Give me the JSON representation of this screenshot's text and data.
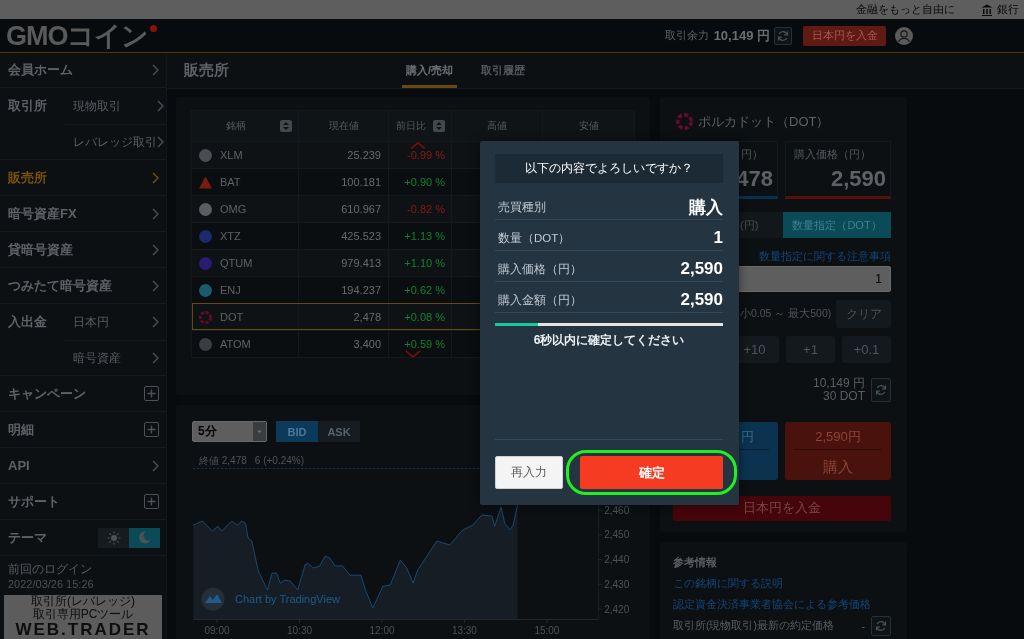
{
  "top_strip": {
    "tagline": "金融をもっと自由に",
    "bank_link": "銀行"
  },
  "header": {
    "logo": "GMOコイン",
    "balance_label": "取引余力",
    "balance_value": "10,149 円",
    "deposit_button": "日本円を入金"
  },
  "sidebar": {
    "items": [
      {
        "label": "会員ホーム",
        "kind": "link",
        "selected": false
      },
      {
        "label": "取引所",
        "kind": "group",
        "selected": false,
        "children": [
          {
            "label": "現物取引",
            "selected": false
          },
          {
            "label": "レバレッジ取引",
            "selected": false
          }
        ]
      },
      {
        "label": "販売所",
        "kind": "link",
        "selected": true
      },
      {
        "label": "暗号資産FX",
        "kind": "link",
        "selected": false
      },
      {
        "label": "貸暗号資産",
        "kind": "link",
        "selected": false
      },
      {
        "label": "つみたて暗号資産",
        "kind": "link",
        "selected": false
      },
      {
        "label": "入出金",
        "kind": "group",
        "selected": false,
        "children": [
          {
            "label": "日本円",
            "selected": false
          },
          {
            "label": "暗号資産",
            "selected": false
          }
        ]
      },
      {
        "label": "キャンペーン",
        "kind": "expand",
        "selected": false
      },
      {
        "label": "明細",
        "kind": "expand",
        "selected": false
      },
      {
        "label": "API",
        "kind": "link",
        "selected": false
      },
      {
        "label": "サポート",
        "kind": "expand",
        "selected": false
      },
      {
        "label": "テーマ",
        "kind": "theme",
        "selected": false,
        "options": [
          {
            "kind": "light",
            "selected": false
          },
          {
            "kind": "dark",
            "selected": true
          }
        ]
      }
    ],
    "last_login_label": "前回のログイン",
    "last_login": "2022/03/26 15:26",
    "banner": {
      "caption": "取引所(レバレッジ)取引専用PCツール",
      "title": "WEB.TRADER"
    }
  },
  "page": {
    "title": "販売所",
    "tabs": [
      {
        "label": "購入/売却",
        "selected": true
      },
      {
        "label": "取引履歴",
        "selected": false
      }
    ]
  },
  "market_table": {
    "columns": [
      {
        "label": "銘柄",
        "sortable": true
      },
      {
        "label": "現在値",
        "sortable": false
      },
      {
        "label": "前日比",
        "sortable": true
      },
      {
        "label": "高値",
        "sortable": false
      },
      {
        "label": "安値",
        "sortable": false
      }
    ],
    "rows": [
      {
        "symbol": "XLM",
        "price": "25.239",
        "change": "-0.99 %",
        "rising": false,
        "kind": "circle",
        "color": "#4a4e52",
        "selected": false
      },
      {
        "symbol": "BAT",
        "price": "100.181",
        "change": "+0.90 %",
        "rising": true,
        "kind": "triangle",
        "color": "#7a1c0c",
        "selected": false
      },
      {
        "symbol": "OMG",
        "price": "610.967",
        "change": "-0.82 %",
        "rising": false,
        "kind": "circle",
        "color": "#5a5e62",
        "selected": false
      },
      {
        "symbol": "XTZ",
        "price": "425.523",
        "change": "+1.13 %",
        "rising": true,
        "kind": "circle",
        "color": "#1a2a6a",
        "selected": false
      },
      {
        "symbol": "QTUM",
        "price": "979.413",
        "change": "+1.10 %",
        "rising": true,
        "kind": "circle",
        "color": "#2a1a70",
        "selected": false
      },
      {
        "symbol": "ENJ",
        "price": "194.237",
        "change": "+0.62 %",
        "rising": true,
        "kind": "circle",
        "color": "#1a5a6a",
        "selected": false
      },
      {
        "symbol": "DOT",
        "price": "2,478",
        "change": "+0.08 %",
        "rising": true,
        "kind": "ring",
        "color": "#6a0a2a",
        "selected": true
      },
      {
        "symbol": "ATOM",
        "price": "3,400",
        "change": "+0.59 %",
        "rising": true,
        "kind": "circle",
        "color": "#3a3e42",
        "selected": false
      }
    ]
  },
  "chart": {
    "interval": "5分",
    "sides": [
      {
        "label": "BID",
        "selected": true
      },
      {
        "label": "ASK",
        "selected": false
      }
    ],
    "close_label": "終値 2,478",
    "close_change": "6 (+0.24%)",
    "attribution": "Chart by TradingView",
    "chart_data": {
      "type": "area",
      "x": [
        514,
        524,
        535,
        541,
        545,
        556,
        562,
        567,
        571,
        574,
        578,
        585,
        595,
        600,
        605,
        609,
        614,
        620,
        628,
        636,
        639,
        645,
        652,
        658,
        663,
        669,
        677,
        685,
        697,
        702,
        710,
        721,
        729,
        740,
        747,
        754,
        759,
        769,
        780,
        794,
        808,
        819,
        829,
        840,
        843,
        850,
        854,
        860,
        863,
        868
      ],
      "values": [
        2453.9,
        2455.6,
        2451.5,
        2453.5,
        2451.5,
        2455.6,
        2453.9,
        2455.6,
        2454.7,
        2448.7,
        2447.5,
        2435.4,
        2427.7,
        2434.5,
        2434.5,
        2430.5,
        2431.7,
        2431.3,
        2427.7,
        2437.8,
        2438.6,
        2436.6,
        2437.4,
        2441.4,
        2440.6,
        2437.4,
        2437.4,
        2433.7,
        2433.7,
        2427.7,
        2420.4,
        2429.3,
        2429.7,
        2439.8,
        2436.6,
        2430.5,
        2435.8,
        2441.4,
        2447.5,
        2445.9,
        2451.9,
        2453.9,
        2458,
        2457.6,
        2453.5,
        2461.2,
        2454.7,
        2451.9,
        2453.9,
        2462
      ],
      "xlim": [
        514,
        956
      ],
      "ylim": [
        2416,
        2477
      ],
      "xticks": [
        {
          "value": 540,
          "label": "09:00"
        },
        {
          "value": 630,
          "label": "10:30"
        },
        {
          "value": 720,
          "label": "12:00"
        },
        {
          "value": 810,
          "label": "13:30"
        },
        {
          "value": 900,
          "label": "15:00"
        }
      ],
      "yticks": [
        {
          "value": 2420,
          "label": "2,420"
        },
        {
          "value": 2430,
          "label": "2,430"
        },
        {
          "value": 2440,
          "label": "2,440"
        },
        {
          "value": 2450,
          "label": "2,450"
        },
        {
          "value": 2460,
          "label": "2,460"
        }
      ]
    }
  },
  "order_panel": {
    "title": "ポルカドット（DOT）",
    "sell_price": {
      "label": "円）",
      "value": "478"
    },
    "buy_price": {
      "label": "購入価格（円）",
      "value": "2,590"
    },
    "order_modes": [
      {
        "label": "(円)",
        "selected": false
      },
      {
        "label": "数量指定（DOT）",
        "selected": true
      }
    ],
    "notice_link": "数量指定に関する注意事項",
    "quantity": {
      "value": "1"
    },
    "range": "小0.05 ～ 最大500)",
    "clear_button": "クリア",
    "increments": [
      "+10",
      "+1",
      "+0.1"
    ],
    "available_jpy": "10,149 円",
    "available_dot": "30 DOT",
    "sell_button": {
      "price": "円"
    },
    "buy_button": {
      "price": "2,590円",
      "label": "購入"
    },
    "deposit_button": "日本円を入金"
  },
  "reference": {
    "title": "参考情報",
    "links": [
      "この銘柄に関する説明",
      "認定資金決済事業者協会による参考価格"
    ],
    "last_trade_label": "取引所(現物取引)最新の約定価格",
    "last_trade_value": "-"
  },
  "dialog": {
    "title": "以下の内容でよろしいですか？",
    "rows": [
      {
        "label": "売買種別",
        "value": "購入"
      },
      {
        "label": "数量（DOT）",
        "value": "1"
      },
      {
        "label": "購入価格（円）",
        "value": "2,590"
      },
      {
        "label": "購入金額（円）",
        "value": "2,590"
      }
    ],
    "timer": {
      "level": 0.19
    },
    "countdown": "6秒以内に確定してください",
    "buttons": [
      {
        "label": "再入力",
        "kind": "secondary",
        "highlighted": false
      },
      {
        "label": "確定",
        "kind": "primary",
        "highlighted": true
      }
    ]
  }
}
